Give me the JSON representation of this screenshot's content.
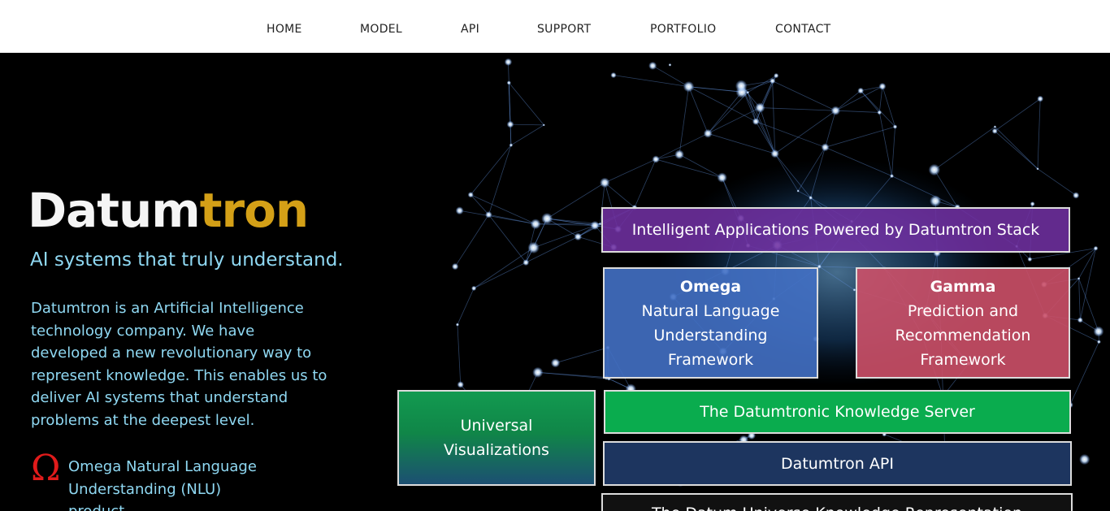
{
  "nav": {
    "items": [
      "HOME",
      "MODEL",
      "API",
      "SUPPORT",
      "PORTFOLIO",
      "CONTACT"
    ]
  },
  "hero": {
    "logo_part1": "Datum",
    "logo_part2": "tron",
    "tagline": "AI systems that truly understand.",
    "intro": "Datumtron is an Artificial Intelligence technology company.  We have developed a new revolutionary way to represent knowledge.  This enables us to deliver AI systems that understand problems at the deepest level.",
    "omega_symbol": "Ω",
    "omega_text": "Omega Natural Language Understanding (NLU) product"
  },
  "stack": {
    "apps": "Intelligent Applications Powered by Datumtron Stack",
    "omega_title": "Omega",
    "omega_body": "Natural Language Understanding Framework",
    "gamma_title": "Gamma",
    "gamma_body": "Prediction and Recommendation Framework",
    "universal": "Universal Visualizations",
    "knowledge_server": "The Datumtronic Knowledge Server",
    "api": "Datumtron API",
    "datum_universe": "The Datum Universe Knowledge Representation"
  },
  "colors": {
    "accent_gold": "#d4a017",
    "text_cyan": "#8fd8f2",
    "omega_red": "#e01b1b",
    "apps_purple": "#7030a0",
    "omega_blue": "#4270c4",
    "gamma_pink": "#cc5068",
    "server_green": "#0aac4e",
    "api_navy": "#1d355f"
  },
  "icons": {
    "omega": "omega-symbol-icon",
    "background": "neural-network-brain-art"
  }
}
